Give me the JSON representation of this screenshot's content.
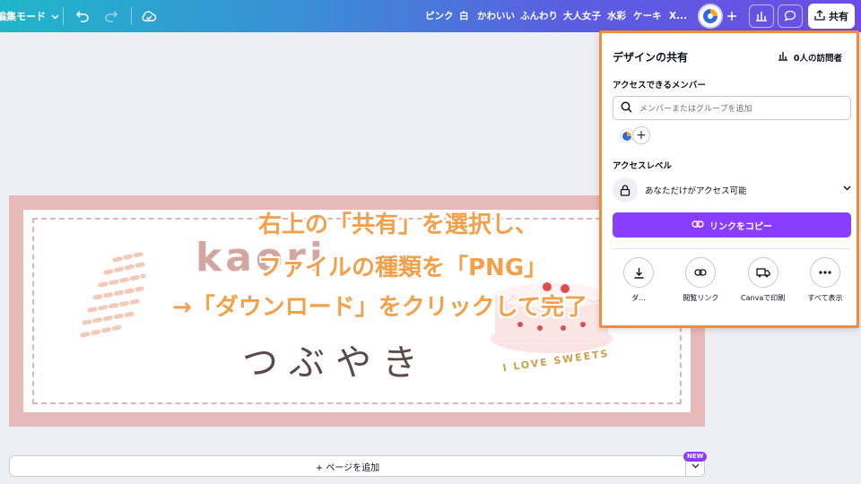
{
  "topbar": {
    "edit_mode_label": "編集モード",
    "keywords": [
      "ピンク",
      "白",
      "かわいい",
      "ふんわり",
      "大人女子",
      "水彩",
      "ケーキ",
      "X..."
    ],
    "share_label": "共有"
  },
  "canvas": {
    "title_text": "kaori",
    "subtitle_text": "つぶやき",
    "sweets_text": "I LOVE SWEETS"
  },
  "add_page": {
    "label": "+ ページを追加",
    "badge": "NEW"
  },
  "share_panel": {
    "title": "デザインの共有",
    "visitors": "0人の訪問者",
    "members_label": "アクセスできるメンバー",
    "search_placeholder": "メンバーまたはグループを追加",
    "access_level_label": "アクセスレベル",
    "access_value": "あなただけがアクセス可能",
    "copy_link_label": "リンクをコピー",
    "actions": [
      {
        "label": "ダ...",
        "icon": "download-icon"
      },
      {
        "label": "閲覧リンク",
        "icon": "link-icon"
      },
      {
        "label": "Canvaで印刷",
        "icon": "truck-icon"
      },
      {
        "label": "すべて表示",
        "icon": "more-icon"
      }
    ]
  },
  "overlay": {
    "line1": "右上の「共有」を選択し、",
    "line2": "ファイルの種類を「PNG」",
    "line3": "→「ダウンロード」をクリックして完了"
  },
  "colors": {
    "accent_purple": "#8b3dff",
    "overlay_orange": "#f2a04a",
    "panel_border": "#f28c3a",
    "canvas_pink": "#e8b9b9"
  }
}
